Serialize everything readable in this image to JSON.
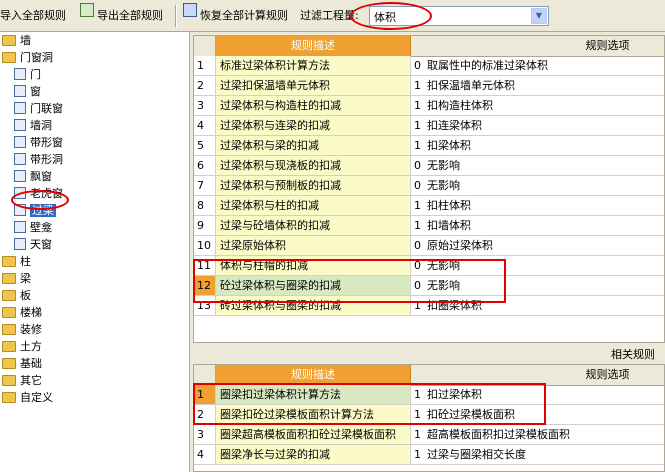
{
  "toolbar": {
    "import_label": "导入全部规则",
    "export_label": "导出全部规则",
    "restore_label": "恢复全部计算规则",
    "filter_label": "过滤工程量:",
    "filter_value": "体积"
  },
  "tree": {
    "items": [
      {
        "label": "墙",
        "type": "folder"
      },
      {
        "label": "门窗洞",
        "type": "folder"
      },
      {
        "label": "门",
        "type": "leaf"
      },
      {
        "label": "窗",
        "type": "leaf"
      },
      {
        "label": "门联窗",
        "type": "leaf"
      },
      {
        "label": "墙洞",
        "type": "leaf"
      },
      {
        "label": "带形窗",
        "type": "leaf"
      },
      {
        "label": "带形洞",
        "type": "leaf"
      },
      {
        "label": "飘窗",
        "type": "leaf"
      },
      {
        "label": "老虎窗",
        "type": "leaf"
      },
      {
        "label": "过梁",
        "type": "leaf",
        "selected": true
      },
      {
        "label": "壁龛",
        "type": "leaf"
      },
      {
        "label": "天窗",
        "type": "leaf"
      },
      {
        "label": "柱",
        "type": "folder"
      },
      {
        "label": "梁",
        "type": "folder"
      },
      {
        "label": "板",
        "type": "folder"
      },
      {
        "label": "楼梯",
        "type": "folder"
      },
      {
        "label": "装修",
        "type": "folder"
      },
      {
        "label": "土方",
        "type": "folder"
      },
      {
        "label": "基础",
        "type": "folder"
      },
      {
        "label": "其它",
        "type": "folder"
      },
      {
        "label": "自定义",
        "type": "folder"
      }
    ]
  },
  "main_grid": {
    "header_desc": "规则描述",
    "header_opt": "规则选项",
    "rows": [
      {
        "num": "1",
        "desc": "标准过梁体积计算方法",
        "val": "0",
        "opt": "取属性中的标准过梁体积"
      },
      {
        "num": "2",
        "desc": "过梁扣保温墙单元体积",
        "val": "1",
        "opt": "扣保温墙单元体积"
      },
      {
        "num": "3",
        "desc": "过梁体积与构造柱的扣减",
        "val": "1",
        "opt": "扣构造柱体积"
      },
      {
        "num": "4",
        "desc": "过梁体积与连梁的扣减",
        "val": "1",
        "opt": "扣连梁体积"
      },
      {
        "num": "5",
        "desc": "过梁体积与梁的扣减",
        "val": "1",
        "opt": "扣梁体积"
      },
      {
        "num": "6",
        "desc": "过梁体积与现浇板的扣减",
        "val": "0",
        "opt": "无影响"
      },
      {
        "num": "7",
        "desc": "过梁体积与预制板的扣减",
        "val": "0",
        "opt": "无影响"
      },
      {
        "num": "8",
        "desc": "过梁体积与柱的扣减",
        "val": "1",
        "opt": "扣柱体积"
      },
      {
        "num": "9",
        "desc": "过梁与砼墙体积的扣减",
        "val": "1",
        "opt": "扣墙体积"
      },
      {
        "num": "10",
        "desc": "过梁原始体积",
        "val": "0",
        "opt": "原始过梁体积"
      },
      {
        "num": "11",
        "desc": "体积与柱帽的扣减",
        "val": "0",
        "opt": "无影响"
      },
      {
        "num": "12",
        "desc": "砼过梁体积与圈梁的扣减",
        "val": "0",
        "opt": "无影响",
        "selected": true
      },
      {
        "num": "13",
        "desc": "砖过梁体积与圈梁的扣减",
        "val": "1",
        "opt": "扣圈梁体积"
      }
    ]
  },
  "related": {
    "title": "相关规则",
    "header_desc": "规则描述",
    "header_opt": "规则选项",
    "rows": [
      {
        "num": "1",
        "desc": "圈梁扣过梁体积计算方法",
        "val": "1",
        "opt": "扣过梁体积",
        "selected": true
      },
      {
        "num": "2",
        "desc": "圈梁扣砼过梁模板面积计算方法",
        "val": "1",
        "opt": "扣砼过梁模板面积"
      },
      {
        "num": "3",
        "desc": "圈梁超高模板面积扣砼过梁模板面积",
        "val": "1",
        "opt": "超高模板面积扣过梁模板面积"
      },
      {
        "num": "4",
        "desc": "圈梁净长与过梁的扣减",
        "val": "1",
        "opt": "过梁与圈梁相交长度"
      }
    ]
  },
  "colors": {
    "header_orange": "#f0a030",
    "desc_yellow": "#fbfbc8",
    "annotation_red": "#e00000"
  }
}
